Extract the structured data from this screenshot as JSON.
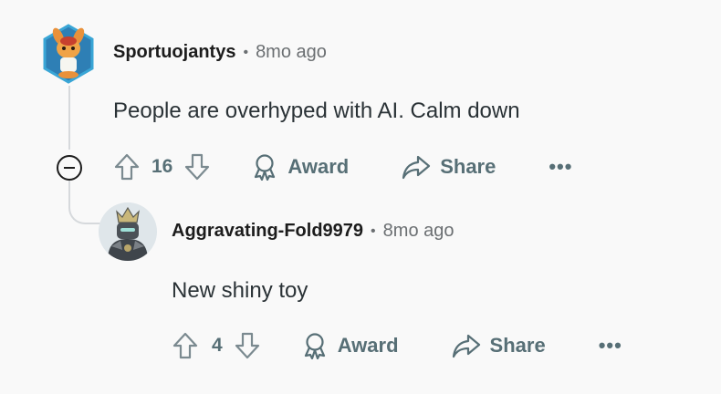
{
  "comment": {
    "username": "Sportuojantys",
    "time": "8mo ago",
    "separator": "•",
    "text": "People are overhyped with AI. Calm down",
    "votes": "16",
    "award_label": "Award",
    "share_label": "Share",
    "more_label": "•••",
    "avatar_icon": "fox-mascot-avatar-icon"
  },
  "reply": {
    "username": "Aggravating-Fold9979",
    "time": "8mo ago",
    "separator": "•",
    "text": "New shiny toy",
    "votes": "4",
    "award_label": "Award",
    "share_label": "Share",
    "more_label": "•••",
    "avatar_icon": "armored-knight-avatar-icon"
  },
  "colors": {
    "background": "#f9f9f9",
    "action_text": "#576f76",
    "thread_line": "#d6d9dc",
    "avatar_ring": "#2ea7c8"
  }
}
